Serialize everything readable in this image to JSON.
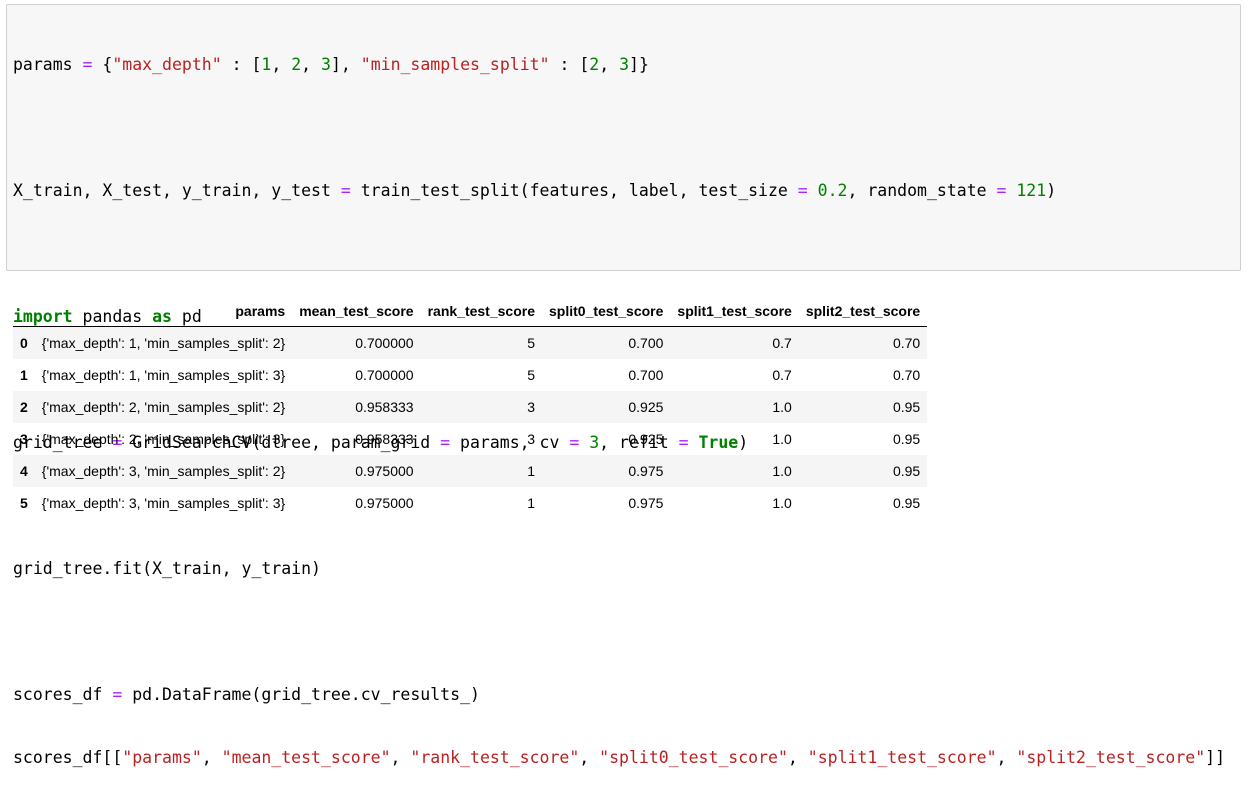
{
  "code_cell": {
    "lines": {
      "params": {
        "var": "params",
        "eq": "=",
        "open": "{",
        "key1": "\"max_depth\"",
        "colon1": ":",
        "lb1": "[",
        "v1": "1",
        "c1": ",",
        "v2": "2",
        "c2": ",",
        "v3": "3",
        "rb1": "],",
        "key2": "\"min_samples_split\"",
        "colon2": ":",
        "lb2": "[",
        "v4": "2",
        "c3": ",",
        "v5": "3",
        "close": "]}"
      },
      "split": {
        "lhs": "X_train, X_test, y_train, y_test",
        "eq": "=",
        "call": "train_test_split(features, label, test_size",
        "eq2": "=",
        "size": "0.2",
        "mid": ", random_state",
        "eq3": "=",
        "seed": "121",
        "end": ")"
      },
      "import": {
        "kw_import": "import",
        "module": "pandas",
        "kw_as": "as",
        "alias": "pd"
      },
      "grid": {
        "lhs": "grid_tree",
        "eq": "=",
        "call": "GridSearchCV(dtree, param_grid",
        "eq2": "=",
        "arg": "params, cv",
        "eq3": "=",
        "cv": "3",
        "mid": ", refit",
        "eq4": "=",
        "refit": "True",
        "end": ")"
      },
      "fit": {
        "text": "grid_tree.fit(X_train, y_train)"
      },
      "df": {
        "lhs": "scores_df",
        "eq": "=",
        "rhs": "pd.DataFrame(grid_tree.cv_results_)"
      },
      "select": {
        "start": "scores_df[[",
        "s1": "\"params\"",
        "s2": "\"mean_test_score\"",
        "s3": "\"rank_test_score\"",
        "s4": "\"split0_test_score\"",
        "s5": "\"split1_test_score\"",
        "s6": "\"split2_test_score\"",
        "sep": ", ",
        "end": "]]"
      }
    }
  },
  "output_table": {
    "columns": [
      "params",
      "mean_test_score",
      "rank_test_score",
      "split0_test_score",
      "split1_test_score",
      "split2_test_score"
    ],
    "rows": [
      {
        "index": "0",
        "params": "{'max_depth': 1, 'min_samples_split': 2}",
        "mean_test_score": "0.700000",
        "rank_test_score": "5",
        "split0_test_score": "0.700",
        "split1_test_score": "0.7",
        "split2_test_score": "0.70"
      },
      {
        "index": "1",
        "params": "{'max_depth': 1, 'min_samples_split': 3}",
        "mean_test_score": "0.700000",
        "rank_test_score": "5",
        "split0_test_score": "0.700",
        "split1_test_score": "0.7",
        "split2_test_score": "0.70"
      },
      {
        "index": "2",
        "params": "{'max_depth': 2, 'min_samples_split': 2}",
        "mean_test_score": "0.958333",
        "rank_test_score": "3",
        "split0_test_score": "0.925",
        "split1_test_score": "1.0",
        "split2_test_score": "0.95"
      },
      {
        "index": "3",
        "params": "{'max_depth': 2, 'min_samples_split': 3}",
        "mean_test_score": "0.958333",
        "rank_test_score": "3",
        "split0_test_score": "0.925",
        "split1_test_score": "1.0",
        "split2_test_score": "0.95"
      },
      {
        "index": "4",
        "params": "{'max_depth': 3, 'min_samples_split': 2}",
        "mean_test_score": "0.975000",
        "rank_test_score": "1",
        "split0_test_score": "0.975",
        "split1_test_score": "1.0",
        "split2_test_score": "0.95"
      },
      {
        "index": "5",
        "params": "{'max_depth': 3, 'min_samples_split': 3}",
        "mean_test_score": "0.975000",
        "rank_test_score": "1",
        "split0_test_score": "0.975",
        "split1_test_score": "1.0",
        "split2_test_score": "0.95"
      }
    ]
  }
}
